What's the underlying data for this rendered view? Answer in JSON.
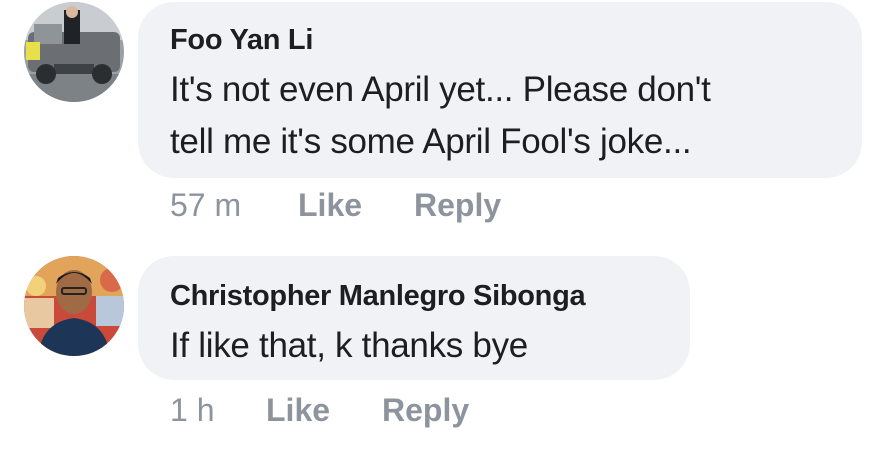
{
  "comments": [
    {
      "author": "Foo Yan Li",
      "text_lines": [
        "It's not even April yet... Please don't",
        "tell me it's some April Fool's joke..."
      ],
      "time": "57 m",
      "like_label": "Like",
      "reply_label": "Reply"
    },
    {
      "author": "Christopher Manlegro Sibonga",
      "text_lines": [
        "If like that, k thanks bye"
      ],
      "time": "1 h",
      "like_label": "Like",
      "reply_label": "Reply"
    }
  ],
  "colors": {
    "bubble": "#f0f2f5",
    "name": "#1c1e21",
    "meta": "#8d949e"
  }
}
